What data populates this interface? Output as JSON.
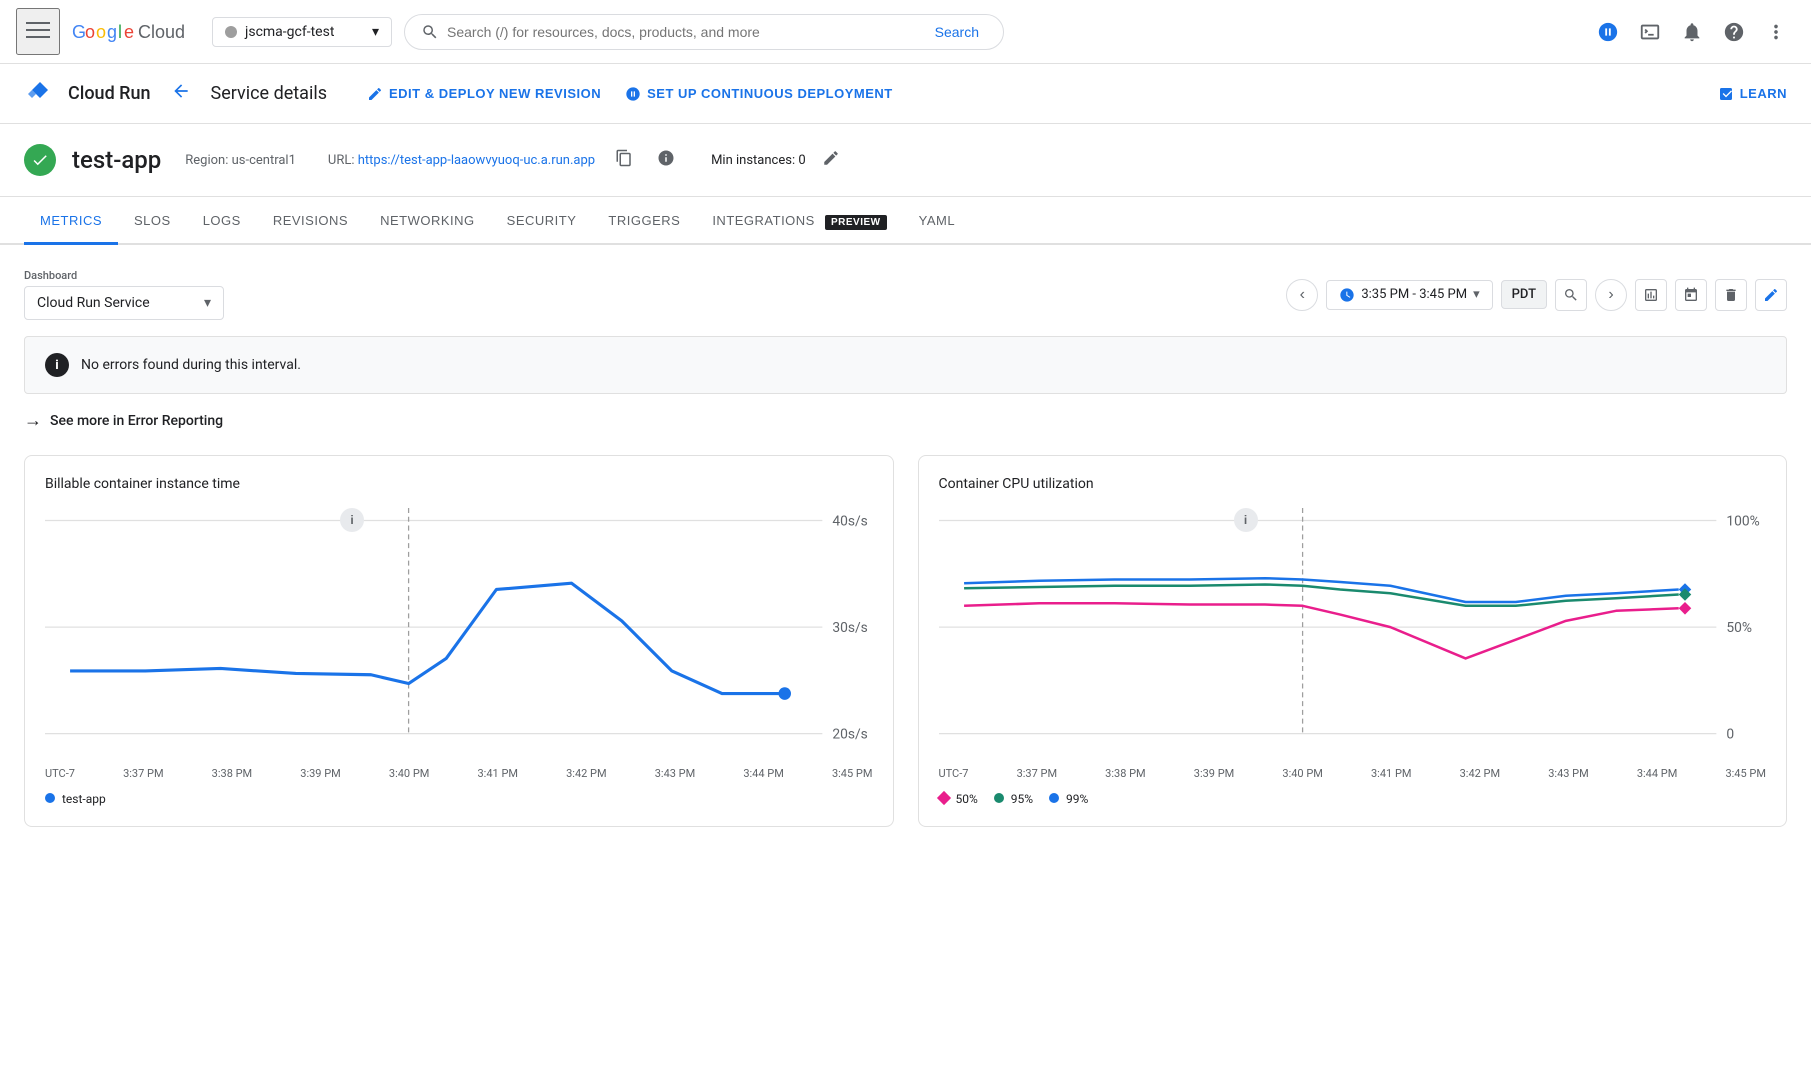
{
  "topNav": {
    "menuIcon": "☰",
    "logoLetters": [
      "G",
      "o",
      "o",
      "g",
      "l",
      "e"
    ],
    "logoColors": [
      "#4285f4",
      "#ea4335",
      "#fbbc05",
      "#4285f4",
      "#34a853",
      "#ea4335"
    ],
    "cloudText": "Cloud",
    "projectSelector": {
      "name": "jscma-gcf-test",
      "chevron": "▾"
    },
    "searchPlaceholder": "Search (/) for resources, docs, products, and more",
    "searchLabel": "Search",
    "icons": [
      "✦",
      "▣",
      "🔔",
      "?",
      "⋮"
    ]
  },
  "serviceHeader": {
    "backIcon": "←",
    "pageTitle": "Service details",
    "editDeployLabel": "EDIT & DEPLOY NEW REVISION",
    "continuousDeployLabel": "SET UP CONTINUOUS DEPLOYMENT",
    "learnLabel": "LEARN"
  },
  "serviceInfo": {
    "appName": "test-app",
    "regionLabel": "Region:",
    "region": "us-central1",
    "urlLabel": "URL:",
    "url": "https://test-app-laaowvyuoq-uc.a.run.app",
    "minInstancesLabel": "Min instances:",
    "minInstances": "0"
  },
  "tabs": [
    {
      "id": "metrics",
      "label": "METRICS",
      "active": true,
      "preview": false
    },
    {
      "id": "slos",
      "label": "SLOS",
      "active": false,
      "preview": false
    },
    {
      "id": "logs",
      "label": "LOGS",
      "active": false,
      "preview": false
    },
    {
      "id": "revisions",
      "label": "REVISIONS",
      "active": false,
      "preview": false
    },
    {
      "id": "networking",
      "label": "NETWORKING",
      "active": false,
      "preview": false
    },
    {
      "id": "security",
      "label": "SECURITY",
      "active": false,
      "preview": false
    },
    {
      "id": "triggers",
      "label": "TRIGGERS",
      "active": false,
      "preview": false
    },
    {
      "id": "integrations",
      "label": "INTEGRATIONS",
      "active": false,
      "preview": true
    },
    {
      "id": "yaml",
      "label": "YAML",
      "active": false,
      "preview": false
    }
  ],
  "metrics": {
    "dashboardLabel": "Dashboard",
    "dashboardValue": "Cloud Run Service",
    "timeRange": "3:35 PM - 3:45 PM",
    "timezone": "PDT",
    "errorBannerText": "No errors found during this interval.",
    "errorReportingLink": "See more in Error Reporting",
    "charts": [
      {
        "id": "billable",
        "title": "Billable container instance time",
        "yLabels": [
          "40s/s",
          "30s/s",
          "20s/s"
        ],
        "xLabels": [
          "UTC-7",
          "3:37 PM",
          "3:38 PM",
          "3:39 PM",
          "3:40 PM",
          "3:41 PM",
          "3:42 PM",
          "3:43 PM",
          "3:44 PM",
          "3:45 PM"
        ],
        "legend": [
          {
            "type": "dot",
            "color": "#1a73e8",
            "label": "test-app"
          }
        ],
        "lineColor": "#1a73e8"
      },
      {
        "id": "cpu",
        "title": "Container CPU utilization",
        "yLabels": [
          "100%",
          "50%",
          "0"
        ],
        "xLabels": [
          "UTC-7",
          "3:37 PM",
          "3:38 PM",
          "3:39 PM",
          "3:40 PM",
          "3:41 PM",
          "3:42 PM",
          "3:43 PM",
          "3:44 PM",
          "3:45 PM"
        ],
        "legend": [
          {
            "type": "diamond",
            "color": "#e91e8c",
            "label": "50%"
          },
          {
            "type": "dot",
            "color": "#1a8a6e",
            "label": "95%"
          },
          {
            "type": "dot",
            "color": "#1a73e8",
            "label": "99%"
          }
        ]
      }
    ]
  }
}
